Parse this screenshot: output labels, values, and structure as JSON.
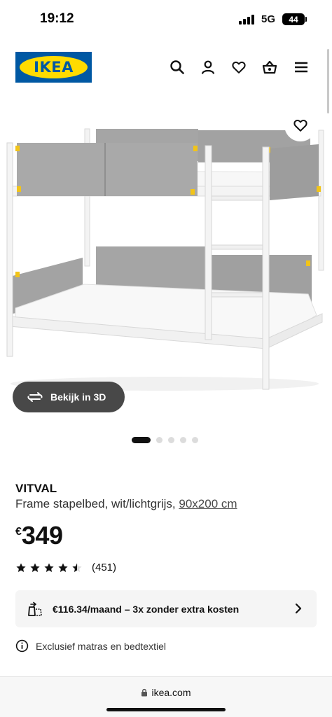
{
  "status_bar": {
    "time": "19:12",
    "network": "5G",
    "battery": "44"
  },
  "header": {
    "logo_text": "IKEA",
    "icons": [
      "search-icon",
      "account-icon",
      "heart-icon",
      "basket-icon",
      "menu-icon"
    ]
  },
  "gallery": {
    "view3d_label": "Bekijk in 3D",
    "slide_count": 5,
    "active_slide": 1
  },
  "product": {
    "name": "VITVAL",
    "description": "Frame stapelbed, wit/lichtgrijs,",
    "size": "90x200 cm",
    "currency": "€",
    "price": "349",
    "rating": 4.5,
    "rating_max": 5,
    "review_count": "(451)"
  },
  "finance": {
    "text": "€116.34/maand – 3x zonder extra kosten"
  },
  "note": {
    "text": "Exclusief matras en bedtextiel"
  },
  "browser": {
    "url": "ikea.com"
  },
  "colors": {
    "brand_blue": "#0058a3",
    "brand_yellow": "#ffdb00",
    "button_dark": "#484848",
    "panel_bg": "#f5f5f5"
  }
}
